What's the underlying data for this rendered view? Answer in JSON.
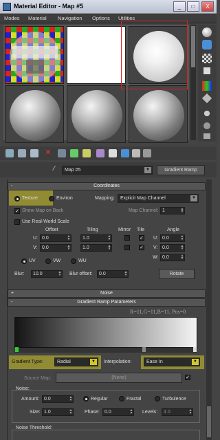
{
  "window": {
    "title": "Material Editor - Map #5",
    "minimize": "_",
    "maximize": "□",
    "close": "X"
  },
  "menu": [
    "Modes",
    "Material",
    "Navigation",
    "Options",
    "Utilities"
  ],
  "map": {
    "name": "Map #5",
    "type_button": "Gradient Ramp"
  },
  "coordinates": {
    "title": "Coordinates",
    "texture_label": "Texture",
    "environ_label": "Environ",
    "mapping_label": "Mapping:",
    "mapping_value": "Explicit Map Channel",
    "show_map_on_back": "Show Map on Back",
    "map_channel_label": "Map Channel:",
    "map_channel_value": "1",
    "use_real_world": "Use Real-World Scale",
    "headers": {
      "offset": "Offset",
      "tiling": "Tiling",
      "mirror": "Mirror",
      "tile": "Tile",
      "angle": "Angle"
    },
    "u_label": "U:",
    "v_label": "V:",
    "w_label": "W:",
    "u_offset": "0.0",
    "v_offset": "0.0",
    "u_tiling": "1.0",
    "v_tiling": "1.0",
    "u_angle": "0.0",
    "v_angle": "0.0",
    "w_angle": "0.0",
    "uv": "UV",
    "vw": "VW",
    "wu": "WU",
    "blur_label": "Blur:",
    "blur_value": "10.0",
    "blur_offset_label": "Blur offset:",
    "blur_offset_value": "0.0",
    "rotate": "Rotate"
  },
  "noise_rollout": {
    "title": "Noise",
    "sign": "+"
  },
  "gradient_ramp": {
    "title": "Gradient Ramp Parameters",
    "flag_readout": "R=11,G=11,B=11, Pos=0",
    "gradient_type_label": "Gradient Type:",
    "gradient_type_value": "Radial",
    "interpolation_label": "Interpolation:",
    "interpolation_value": "Ease In",
    "source_map_label": "Source Map:",
    "source_map_value": "(None)",
    "noise_label": "Noise:",
    "amount_label": "Amount:",
    "amount_value": "0.0",
    "regular": "Regular",
    "fractal": "Fractal",
    "turbulence": "Turbulence",
    "size_label": "Size:",
    "size_value": "1.0",
    "phase_label": "Phase:",
    "phase_value": "0.0",
    "levels_label": "Levels:",
    "levels_value": "4.0",
    "noise_threshold_label": "Noise Threshold:"
  },
  "colors": {
    "highlight": "#d2c828",
    "selection_red": "#e02020",
    "panel": "#444444"
  }
}
